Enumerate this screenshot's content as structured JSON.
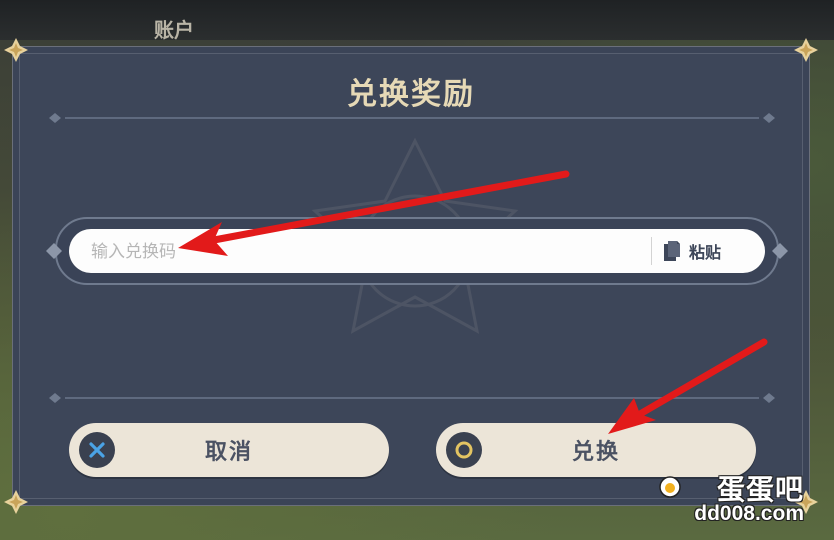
{
  "background": {
    "account_label": "账户"
  },
  "dialog": {
    "title": "兑换奖励",
    "input": {
      "placeholder": "输入兑换码",
      "value": ""
    },
    "paste_label": "粘贴",
    "buttons": {
      "cancel_label": "取消",
      "confirm_label": "兑换"
    }
  },
  "watermark": {
    "brand": "蛋蛋吧",
    "url": "dd008.com"
  },
  "colors": {
    "dialog_bg": "#3d4659",
    "title_gold": "#e6d9b6",
    "button_bg": "#ece5d8",
    "annotation_red": "#e21a1a",
    "cancel_icon_blue": "#4aa3e6",
    "confirm_icon_gold": "#e3c462"
  },
  "icons": {
    "paste": "clipboard-icon",
    "cancel": "close-x-icon",
    "confirm": "circle-o-icon"
  }
}
